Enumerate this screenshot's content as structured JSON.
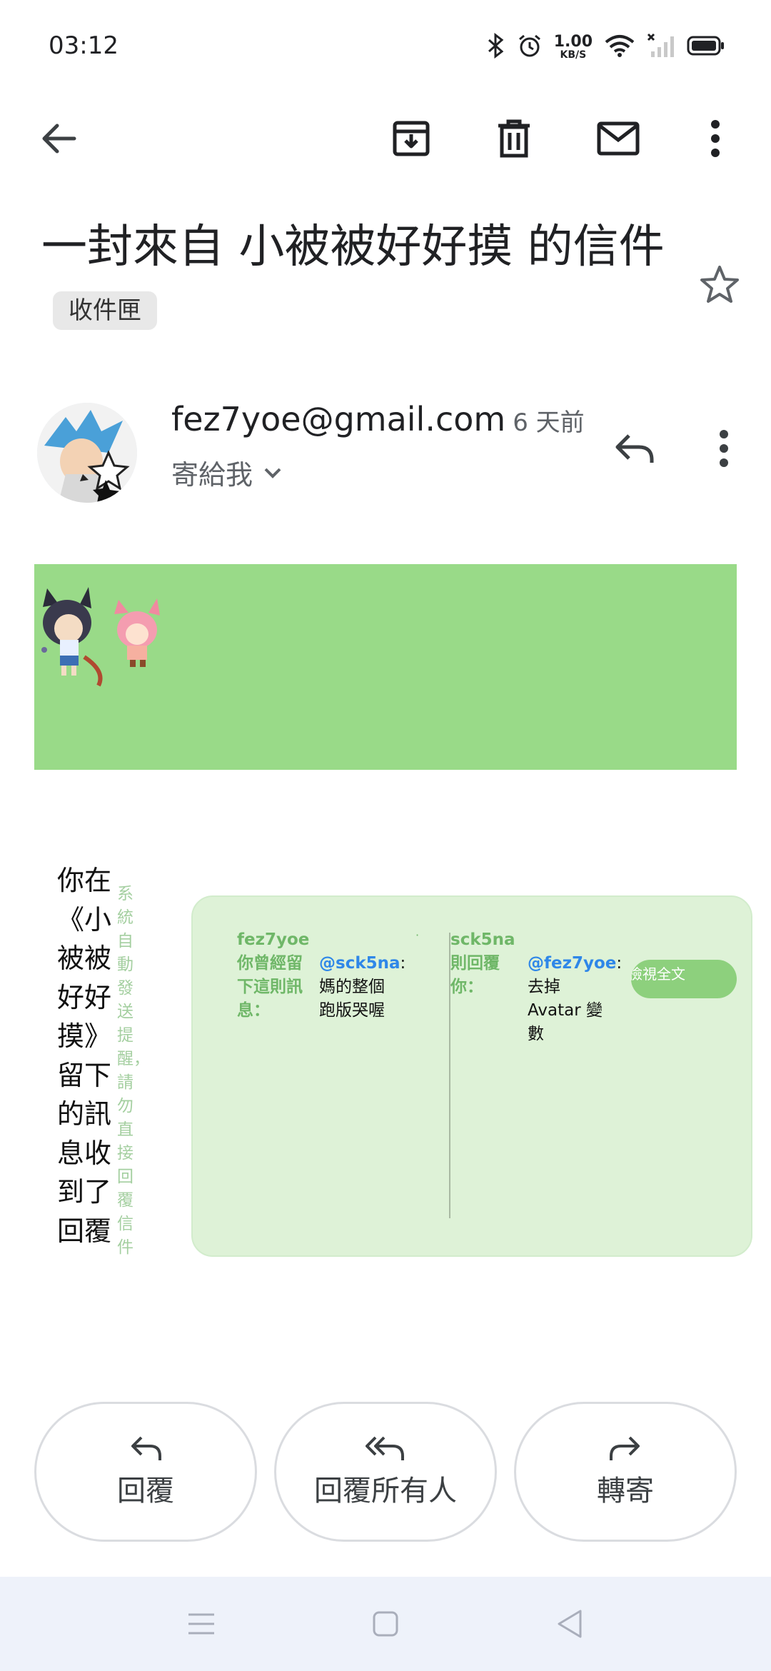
{
  "status_bar": {
    "time": "03:12",
    "net_speed_value": "1.00",
    "net_speed_unit": "KB/S",
    "icons": [
      "bluetooth-icon",
      "alarm-icon",
      "wifi-icon",
      "signal-icon",
      "battery-icon"
    ]
  },
  "app_bar": {
    "icons": [
      "back-arrow-icon",
      "archive-icon",
      "delete-icon",
      "mail-icon",
      "more-vert-icon"
    ]
  },
  "email": {
    "subject": "一封來自 小被被好好摸 的信件",
    "label": "收件匣",
    "sender_email": "fez7yoe@gmail.com",
    "time_ago": "6 天前",
    "recipient": "寄給我"
  },
  "body": {
    "notice": "你在《小被被好好摸》留下的訊息收到了回覆",
    "auto_note": "系統自動發送提醒，請勿直接回覆信件",
    "left_label": "fez7yoe 你曾經留下這則訊息：",
    "left_mention": "@sck5na",
    "left_colon": ":",
    "left_message": "媽的整個跑版哭喔",
    "dot": "·",
    "right_label": "sck5na 則回覆你：",
    "right_mention": "@fez7yoe",
    "right_colon": ":",
    "right_message": "去掉 Avatar 變數",
    "view_full": "檢視全文"
  },
  "actions": {
    "reply": "回覆",
    "reply_all": "回覆所有人",
    "forward": "轉寄"
  },
  "colors": {
    "banner": "#99da88",
    "card": "#def2d7",
    "label_green": "#6fb768",
    "mention_blue": "#2f87e8",
    "nav_bg": "#eef2fa"
  }
}
